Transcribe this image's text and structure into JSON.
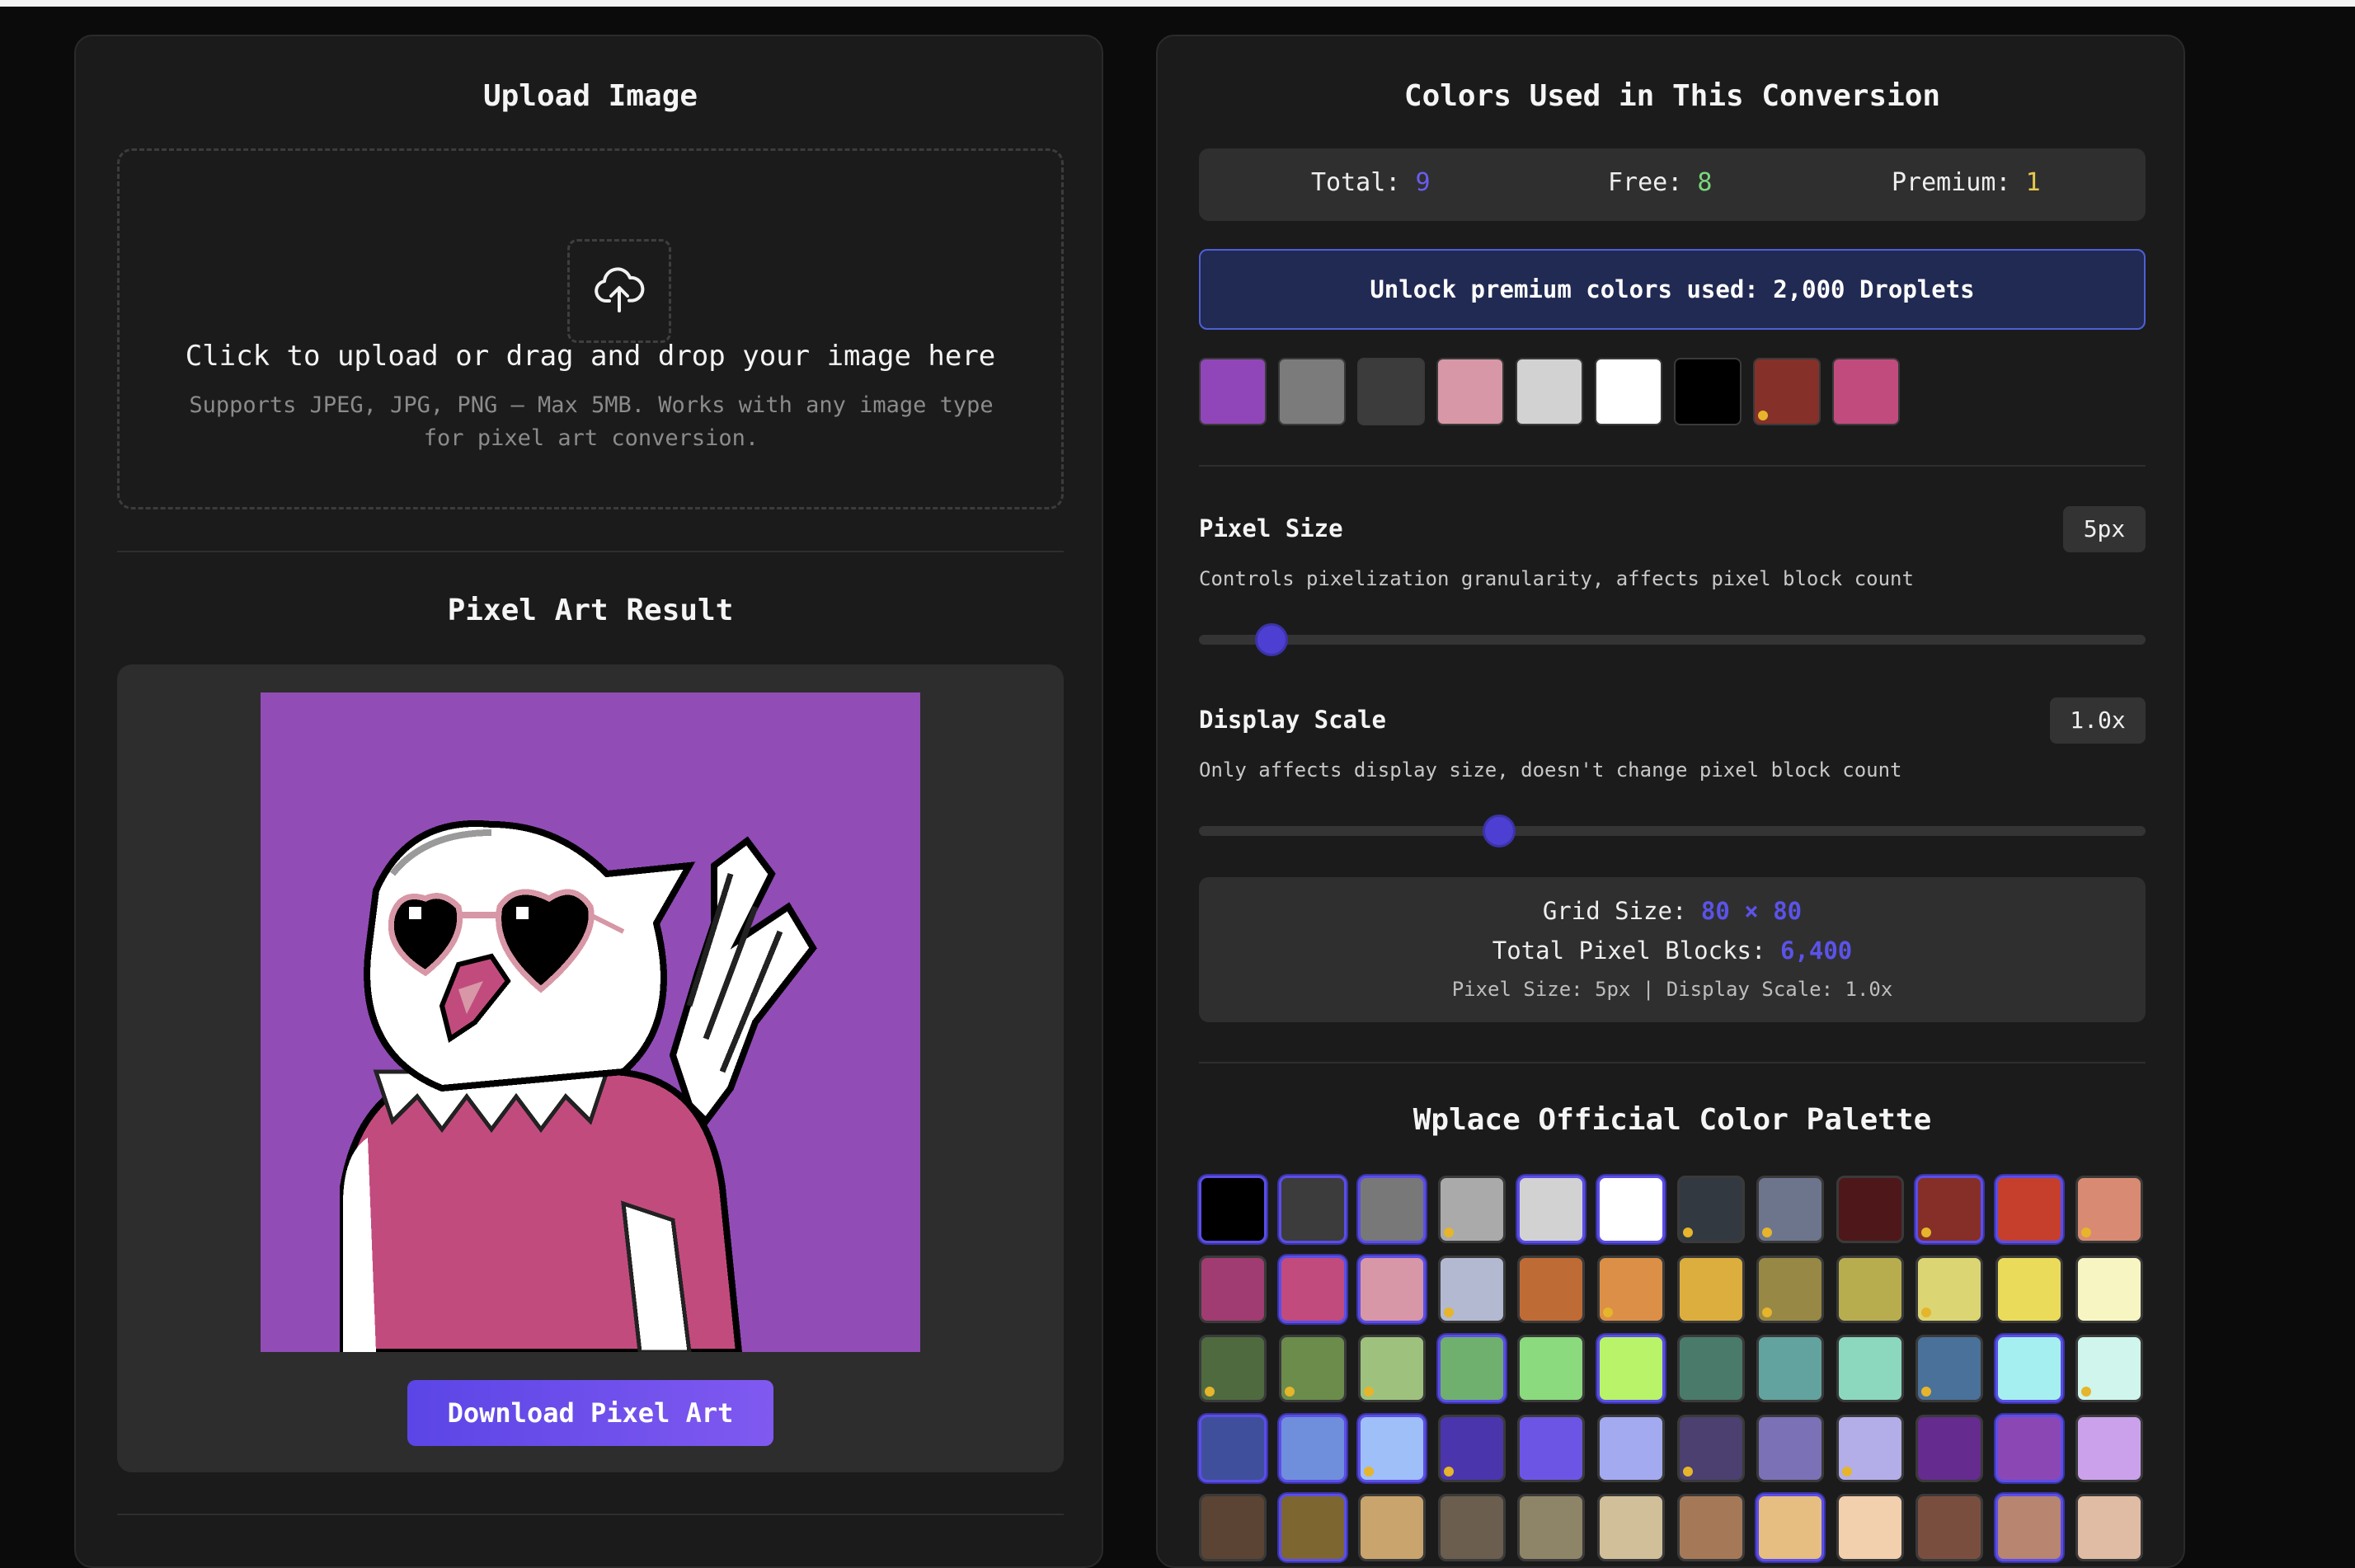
{
  "upload": {
    "title": "Upload Image",
    "prompt": "Click to upload or drag and drop your image here",
    "hint": "Supports JPEG, JPG, PNG — Max 5MB. Works with any image type for pixel art conversion."
  },
  "result": {
    "title": "Pixel Art Result",
    "download_label": "Download Pixel Art"
  },
  "colors_used": {
    "title": "Colors Used in This Conversion",
    "total_label": "Total:",
    "total_value": "9",
    "free_label": "Free:",
    "free_value": "8",
    "premium_label": "Premium:",
    "premium_value": "1",
    "unlock_label": "Unlock premium colors used: 2,000 Droplets",
    "swatches": [
      {
        "color": "#9046b8",
        "premium": false
      },
      {
        "color": "#7b7b7b",
        "premium": false
      },
      {
        "color": "#3c3c3c",
        "premium": false
      },
      {
        "color": "#d797a6",
        "premium": false
      },
      {
        "color": "#d2d2d2",
        "premium": false
      },
      {
        "color": "#ffffff",
        "premium": false
      },
      {
        "color": "#000000",
        "premium": false
      },
      {
        "color": "#86302a",
        "premium": true
      },
      {
        "color": "#c24b7e",
        "premium": false
      }
    ]
  },
  "pixel_size": {
    "label": "Pixel Size",
    "value": "5px",
    "description": "Controls pixelization granularity, affects pixel block count",
    "slider_fraction": 0.077
  },
  "display_scale": {
    "label": "Display Scale",
    "value": "1.0x",
    "description": "Only affects display size, doesn't change pixel block count",
    "slider_fraction": 0.317
  },
  "grid_info": {
    "grid_label": "Grid Size:",
    "grid_value": "80 × 80",
    "blocks_label": "Total Pixel Blocks:",
    "blocks_value": "6,400",
    "summary": "Pixel Size: 5px | Display Scale: 1.0x"
  },
  "palette": {
    "title": "Wplace Official Color Palette",
    "colors": [
      {
        "color": "#000000",
        "premium": false,
        "used": true
      },
      {
        "color": "#3c3c3c",
        "premium": false,
        "used": true
      },
      {
        "color": "#787878",
        "premium": false,
        "used": true
      },
      {
        "color": "#aaaaaa",
        "premium": true,
        "used": false
      },
      {
        "color": "#d2d2d2",
        "premium": false,
        "used": true
      },
      {
        "color": "#ffffff",
        "premium": false,
        "used": true
      },
      {
        "color": "#333941",
        "premium": true,
        "used": false
      },
      {
        "color": "#6d758d",
        "premium": true,
        "used": false
      },
      {
        "color": "#4e1719",
        "premium": false,
        "used": false
      },
      {
        "color": "#852f28",
        "premium": true,
        "used": true
      },
      {
        "color": "#c63f2c",
        "premium": false,
        "used": true
      },
      {
        "color": "#d98a72",
        "premium": true,
        "used": false
      },
      {
        "color": "#a03c71",
        "premium": false,
        "used": false
      },
      {
        "color": "#c24b7e",
        "premium": false,
        "used": true
      },
      {
        "color": "#d897a7",
        "premium": false,
        "used": true
      },
      {
        "color": "#b3b9d1",
        "premium": true,
        "used": false
      },
      {
        "color": "#bf6b35",
        "premium": false,
        "used": false
      },
      {
        "color": "#dc8f47",
        "premium": true,
        "used": false
      },
      {
        "color": "#dcae3d",
        "premium": false,
        "used": false
      },
      {
        "color": "#978845",
        "premium": true,
        "used": false
      },
      {
        "color": "#b8ad4e",
        "premium": false,
        "used": false
      },
      {
        "color": "#dbd673",
        "premium": true,
        "used": false
      },
      {
        "color": "#ebdb5a",
        "premium": false,
        "used": false
      },
      {
        "color": "#f7f5c1",
        "premium": false,
        "used": false
      },
      {
        "color": "#4f6a3f",
        "premium": true,
        "used": false
      },
      {
        "color": "#6b8c4b",
        "premium": true,
        "used": false
      },
      {
        "color": "#9ec27d",
        "premium": true,
        "used": false
      },
      {
        "color": "#6fb06f",
        "premium": false,
        "used": true
      },
      {
        "color": "#8bda7d",
        "premium": false,
        "used": false
      },
      {
        "color": "#b8f36a",
        "premium": false,
        "used": true
      },
      {
        "color": "#4a7a6a",
        "premium": false,
        "used": false
      },
      {
        "color": "#63a39f",
        "premium": false,
        "used": false
      },
      {
        "color": "#8bd8bf",
        "premium": false,
        "used": false
      },
      {
        "color": "#4a7199",
        "premium": true,
        "used": false
      },
      {
        "color": "#a6eff0",
        "premium": false,
        "used": true
      },
      {
        "color": "#d0f5ec",
        "premium": true,
        "used": false
      },
      {
        "color": "#404f9c",
        "premium": false,
        "used": true
      },
      {
        "color": "#6f8fdc",
        "premium": false,
        "used": true
      },
      {
        "color": "#9fbff8",
        "premium": true,
        "used": true
      },
      {
        "color": "#4b35ad",
        "premium": true,
        "used": false
      },
      {
        "color": "#6c55e4",
        "premium": false,
        "used": false
      },
      {
        "color": "#a3aaf0",
        "premium": false,
        "used": false
      },
      {
        "color": "#4b406f",
        "premium": true,
        "used": false
      },
      {
        "color": "#7a71b7",
        "premium": false,
        "used": false
      },
      {
        "color": "#b3aee8",
        "premium": true,
        "used": false
      },
      {
        "color": "#652b8f",
        "premium": false,
        "used": false
      },
      {
        "color": "#8b48b5",
        "premium": false,
        "used": true
      },
      {
        "color": "#caa1ea",
        "premium": false,
        "used": false
      },
      {
        "color": "#5b4433",
        "premium": false,
        "used": false
      },
      {
        "color": "#7e6630",
        "premium": false,
        "used": true
      },
      {
        "color": "#c9a46d",
        "premium": false,
        "used": false
      },
      {
        "color": "#6b5e4e",
        "premium": false,
        "used": false
      },
      {
        "color": "#8e8467",
        "premium": false,
        "used": false
      },
      {
        "color": "#d1bf9a",
        "premium": false,
        "used": false
      },
      {
        "color": "#a57958",
        "premium": false,
        "used": false
      },
      {
        "color": "#e6be82",
        "premium": false,
        "used": true
      },
      {
        "color": "#f2cfad",
        "premium": false,
        "used": false
      },
      {
        "color": "#7a4e3f",
        "premium": false,
        "used": false
      },
      {
        "color": "#b88570",
        "premium": false,
        "used": true
      },
      {
        "color": "#e0bca5",
        "premium": false,
        "used": false
      }
    ]
  }
}
